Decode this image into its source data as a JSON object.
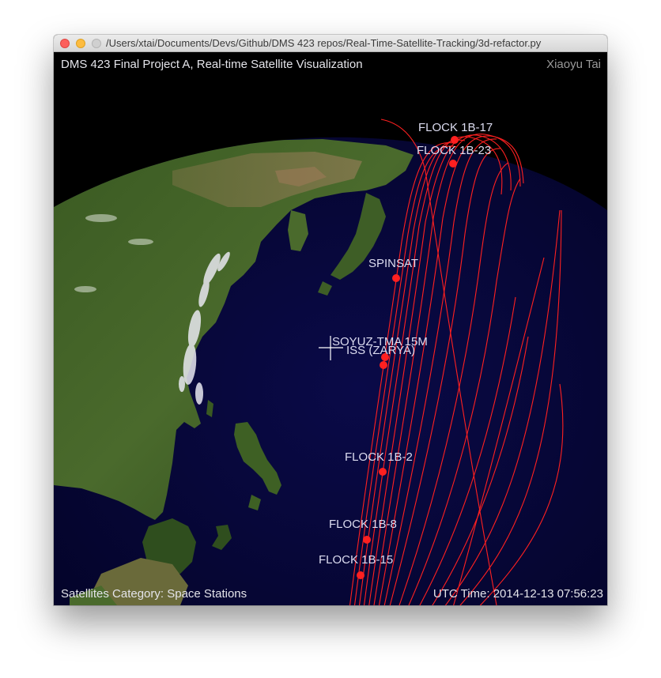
{
  "window": {
    "title": "/Users/xtai/Documents/Devs/Github/DMS 423 repos/Real-Time-Satellite-Tracking/3d-refactor.py"
  },
  "hud": {
    "project_title": "DMS 423 Final Project A, Real-time Satellite Visualization",
    "author": "Xiaoyu Tai",
    "category": "Satellites Category: Space Stations",
    "utc_time": "UTC Time: 2014-12-13 07:56:23"
  },
  "satellites": [
    {
      "name": "FLOCK 1B-17"
    },
    {
      "name": "FLOCK 1B-23"
    },
    {
      "name": "SPINSAT"
    },
    {
      "name": "SOYUZ-TMA 15M"
    },
    {
      "name": "ISS (ZARYA)"
    },
    {
      "name": "FLOCK 1B-2"
    },
    {
      "name": "FLOCK 1B-8"
    },
    {
      "name": "FLOCK 1B-15"
    }
  ],
  "colors": {
    "orbit": "#ff2020",
    "ocean": "#06063a",
    "space": "#000000"
  },
  "icons": {
    "cursor": "crosshair-cursor-icon"
  }
}
